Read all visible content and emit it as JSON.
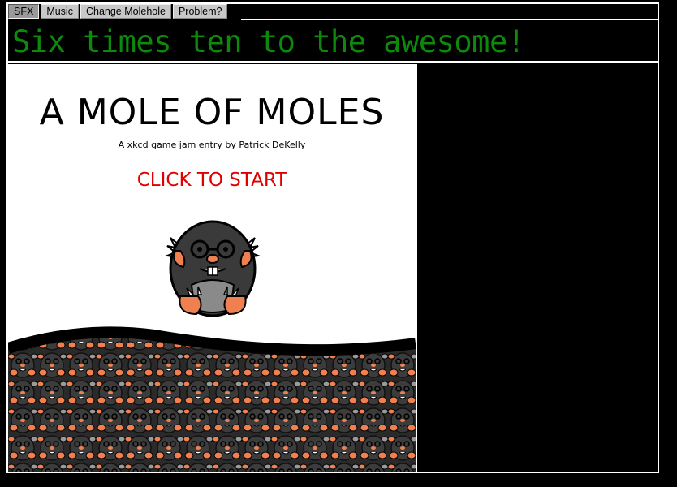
{
  "toolbar": {
    "buttons": [
      {
        "label": "SFX",
        "pressed": true
      },
      {
        "label": "Music",
        "pressed": false
      },
      {
        "label": "Change Molehole",
        "pressed": false
      },
      {
        "label": "Problem?",
        "pressed": false
      }
    ]
  },
  "banner": {
    "text": "Six times ten to the awesome!",
    "color": "#0c8a0c"
  },
  "game": {
    "title": "A MOLE OF MOLES",
    "subtitle": "A xkcd game jam entry by Patrick DeKelly",
    "start_label": "CLICK TO START",
    "start_color": "#e00000",
    "mole_icon": "mole-mascot-icon",
    "ground_icon": "mole-pile-ground"
  },
  "colors": {
    "background": "#000000",
    "mole_body": "#3a3a3a",
    "mole_skin": "#f08050"
  }
}
